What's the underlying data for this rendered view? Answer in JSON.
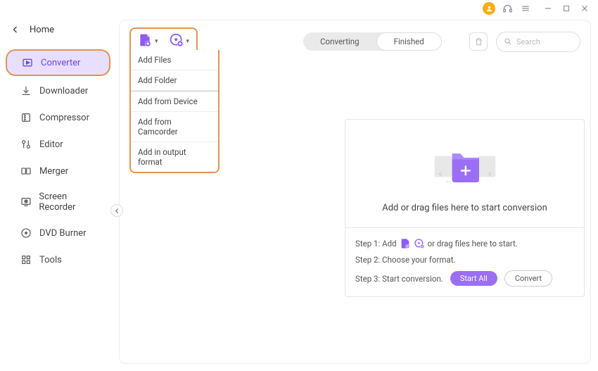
{
  "titlebar": {
    "user_icon": "user-avatar",
    "support_icon": "headset-icon",
    "menu_icon": "hamburger-icon",
    "minimize_icon": "minimize-icon",
    "maximize_icon": "maximize-icon",
    "close_icon": "close-icon"
  },
  "home": {
    "back_icon": "chevron-left-icon",
    "label": "Home"
  },
  "sidebar": {
    "items": [
      {
        "icon": "converter-icon",
        "label": "Converter",
        "active": true
      },
      {
        "icon": "downloader-icon",
        "label": "Downloader"
      },
      {
        "icon": "compressor-icon",
        "label": "Compressor"
      },
      {
        "icon": "editor-icon",
        "label": "Editor"
      },
      {
        "icon": "merger-icon",
        "label": "Merger"
      },
      {
        "icon": "screen-recorder-icon",
        "label": "Screen Recorder"
      },
      {
        "icon": "dvd-burner-icon",
        "label": "DVD Burner"
      },
      {
        "icon": "tools-icon",
        "label": "Tools"
      }
    ],
    "collapse_icon": "chevron-left-icon"
  },
  "topbar": {
    "add_file_icon": "file-plus-icon",
    "add_disc_icon": "disc-plus-icon",
    "dropdown": {
      "group1": [
        "Add Files",
        "Add Folder"
      ],
      "group2": [
        "Add from Device",
        "Add from Camcorder",
        "Add in output format"
      ]
    },
    "tabs": [
      {
        "label": "Converting",
        "active": false
      },
      {
        "label": "Finished",
        "active": true
      }
    ],
    "trash_icon": "trash-icon",
    "search": {
      "icon": "search-icon",
      "placeholder": "Search"
    }
  },
  "content": {
    "dropzone_text": "Add or drag files here to start conversion",
    "folder_icon": "folder-plus-icon",
    "steps": {
      "step1_prefix": "Step 1: Add",
      "step1_suffix": "or drag files here to start.",
      "step2": "Step 2: Choose your format.",
      "step3": "Step 3: Start conversion.",
      "start_all_label": "Start All",
      "convert_label": "Convert"
    }
  },
  "colors": {
    "accent": "#9b6ef5",
    "highlight_border": "#e89050",
    "active_bg": "#e8dfff"
  }
}
